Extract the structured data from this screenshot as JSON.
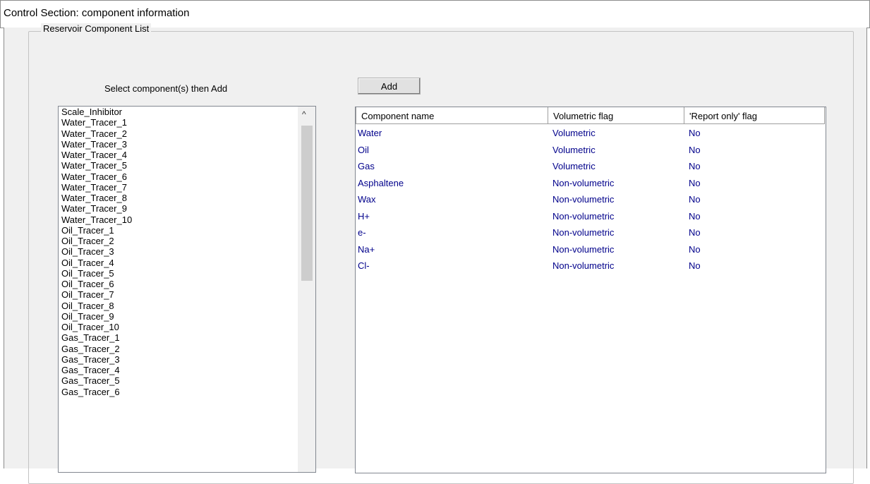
{
  "window": {
    "title": "Control Section: component information"
  },
  "group": {
    "label": "Reservoir Component List"
  },
  "left_panel": {
    "caption": "Select component(s) then Add",
    "items": [
      "Scale_Inhibitor",
      "Water_Tracer_1",
      "Water_Tracer_2",
      "Water_Tracer_3",
      "Water_Tracer_4",
      "Water_Tracer_5",
      "Water_Tracer_6",
      "Water_Tracer_7",
      "Water_Tracer_8",
      "Water_Tracer_9",
      "Water_Tracer_10",
      "Oil_Tracer_1",
      "Oil_Tracer_2",
      "Oil_Tracer_3",
      "Oil_Tracer_4",
      "Oil_Tracer_5",
      "Oil_Tracer_6",
      "Oil_Tracer_7",
      "Oil_Tracer_8",
      "Oil_Tracer_9",
      "Oil_Tracer_10",
      "Gas_Tracer_1",
      "Gas_Tracer_2",
      "Gas_Tracer_3",
      "Gas_Tracer_4",
      "Gas_Tracer_5",
      "Gas_Tracer_6"
    ]
  },
  "toolbar": {
    "add_label": "Add"
  },
  "table": {
    "columns": [
      "Component name",
      "Volumetric flag",
      "'Report only' flag"
    ],
    "rows": [
      [
        "Water",
        "Volumetric",
        "No"
      ],
      [
        "Oil",
        "Volumetric",
        "No"
      ],
      [
        "Gas",
        "Volumetric",
        "No"
      ],
      [
        "Asphaltene",
        "Non-volumetric",
        "No"
      ],
      [
        "Wax",
        "Non-volumetric",
        "No"
      ],
      [
        "H+",
        "Non-volumetric",
        "No"
      ],
      [
        "e-",
        "Non-volumetric",
        "No"
      ],
      [
        "Na+",
        "Non-volumetric",
        "No"
      ],
      [
        "Cl-",
        "Non-volumetric",
        "No"
      ]
    ]
  },
  "icons": {
    "scroll_up": "chevron-up-icon"
  },
  "colors": {
    "row_text": "#00008b",
    "panel_bg": "#f0f0f0"
  }
}
